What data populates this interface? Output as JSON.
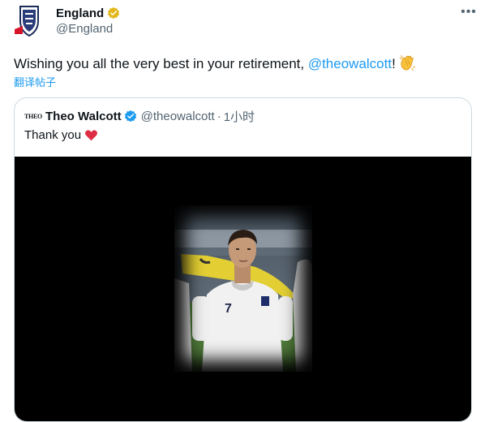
{
  "tweet": {
    "author": {
      "name": "England",
      "handle": "@England",
      "badge": "gold-verified-badge-icon",
      "badge_color": "#e2b719"
    },
    "more_icon": "more-icon",
    "text_before": "Wishing you all the very best in your retirement, ",
    "mention": "@theowalcott",
    "text_after": "!",
    "emoji": "clapping-hands-icon",
    "translate_label": "翻译帖子"
  },
  "quote": {
    "author_logo_text": "THEO",
    "author_name": "Theo Walcott",
    "author_handle": "@theowalcott",
    "separator": "·",
    "time": "1小时",
    "badge": "blue-verified-badge-icon",
    "badge_color": "#1d9bf0",
    "text": "Thank you",
    "emoji": "red-heart-icon",
    "media": "video-player"
  },
  "colors": {
    "accent": "#1d9bf0",
    "text": "#0f1419",
    "secondary": "#536471",
    "border": "#cfd9de"
  }
}
